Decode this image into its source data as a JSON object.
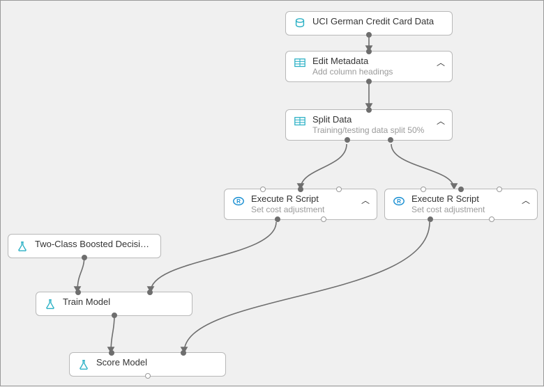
{
  "colors": {
    "iconTeal": "#2ab0c5",
    "iconBlue": "#1a8fd2",
    "connector": "#6e6e6e"
  },
  "nodes": {
    "dataset": {
      "title": "UCI German Credit Card Data",
      "subtitle": null,
      "iconKind": "dataset",
      "chevron": false
    },
    "editMetadata": {
      "title": "Edit Metadata",
      "subtitle": "Add column headings",
      "iconKind": "grid",
      "chevron": true
    },
    "splitData": {
      "title": "Split Data",
      "subtitle": "Training/testing data split 50%",
      "iconKind": "grid",
      "chevron": true
    },
    "rScriptLeft": {
      "title": "Execute R Script",
      "subtitle": "Set cost adjustment",
      "iconKind": "r",
      "chevron": true
    },
    "rScriptRight": {
      "title": "Execute R Script",
      "subtitle": "Set cost adjustment",
      "iconKind": "r",
      "chevron": true
    },
    "algorithm": {
      "title": "Two-Class Boosted Decision...",
      "subtitle": null,
      "iconKind": "flask",
      "chevron": false
    },
    "trainModel": {
      "title": "Train Model",
      "subtitle": null,
      "iconKind": "flask",
      "chevron": false
    },
    "scoreModel": {
      "title": "Score Model",
      "subtitle": null,
      "iconKind": "flask",
      "chevron": false
    }
  }
}
